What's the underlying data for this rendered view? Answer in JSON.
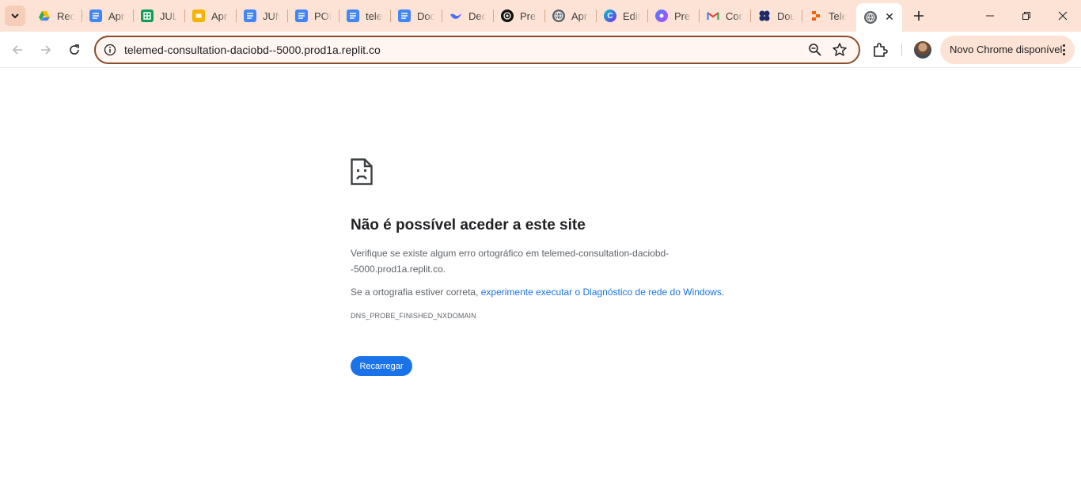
{
  "tabs": [
    {
      "title": "Rec",
      "icon": "google-drive-icon"
    },
    {
      "title": "Apr",
      "icon": "google-docs-icon"
    },
    {
      "title": "JUL",
      "icon": "google-sheets-icon"
    },
    {
      "title": "Apr",
      "icon": "google-slides-icon"
    },
    {
      "title": "JUN",
      "icon": "google-docs-icon"
    },
    {
      "title": "POI",
      "icon": "google-docs-icon"
    },
    {
      "title": "tele",
      "icon": "google-docs-icon"
    },
    {
      "title": "Doc",
      "icon": "google-docs-icon"
    },
    {
      "title": "Dec",
      "icon": "deepseek-icon"
    },
    {
      "title": "Pre",
      "icon": "chatgpt-icon"
    },
    {
      "title": "Apr",
      "icon": "globe-icon"
    },
    {
      "title": "Edit",
      "icon": "canva-icon"
    },
    {
      "title": "Pre",
      "icon": "meta-ai-icon"
    },
    {
      "title": "Con",
      "icon": "gmail-icon"
    },
    {
      "title": "Dou",
      "icon": "tulip-icon"
    },
    {
      "title": "Tele",
      "icon": "replit-icon"
    }
  ],
  "active_tab": {
    "icon": "globe-icon",
    "close": "✕"
  },
  "address_bar": {
    "url": "telemed-consultation-daciobd--5000.prod1a.replit.co"
  },
  "update_button": {
    "label": "Novo Chrome disponível"
  },
  "error": {
    "title": "Não é possível aceder a este site",
    "p1": "Verifique se existe algum erro ortográfico em telemed-consultation-daciobd--5000.prod1a.replit.co.",
    "p2_prefix": "Se a ortografia estiver correta, ",
    "p2_link": "experimente executar o Diagnóstico de rede do Windows",
    "p2_suffix": ".",
    "code": "DNS_PROBE_FINISHED_NXDOMAIN",
    "reload_label": "Recarregar"
  },
  "colors": {
    "accent": "#1a73e8",
    "tabstrip": "#fde3d5",
    "omnibox_border": "#8a4b2a"
  }
}
